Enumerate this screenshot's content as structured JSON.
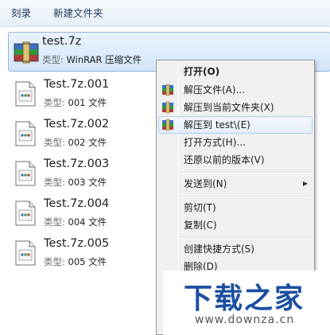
{
  "toolbar": {
    "burn_label": "刻录",
    "new_folder_label": "新建文件夹"
  },
  "type_prefix": "类型: ",
  "files": [
    {
      "name": "test.7z",
      "type": "WinRAR 压缩文件",
      "icon": "winrar-archive-icon"
    },
    {
      "name": "Test.7z.001",
      "type": "001 文件",
      "icon": "generic-file-icon"
    },
    {
      "name": "Test.7z.002",
      "type": "002 文件",
      "icon": "generic-file-icon"
    },
    {
      "name": "Test.7z.003",
      "type": "003 文件",
      "icon": "generic-file-icon"
    },
    {
      "name": "Test.7z.004",
      "type": "004 文件",
      "icon": "generic-file-icon"
    },
    {
      "name": "Test.7z.005",
      "type": "005 文件",
      "icon": "generic-file-icon"
    }
  ],
  "context_menu": {
    "open": "打开(O)",
    "extract_files": "解压文件(A)...",
    "extract_here": "解压到当前文件夹(X)",
    "extract_to": "解压到 test\\(E)",
    "open_with": "打开方式(H)...",
    "restore_versions": "还原以前的版本(V)",
    "send_to": "发送到(N)",
    "cut": "剪切(T)",
    "copy": "复制(C)",
    "create_shortcut": "创建快捷方式(S)",
    "delete": "删除(D)"
  },
  "watermark": {
    "title": "下载之家",
    "url": "www.downza.cn"
  },
  "colors": {
    "selection_border": "#8fb3dd",
    "menu_background": "#f0f0f0",
    "watermark_blue": "#1c4fa0"
  }
}
